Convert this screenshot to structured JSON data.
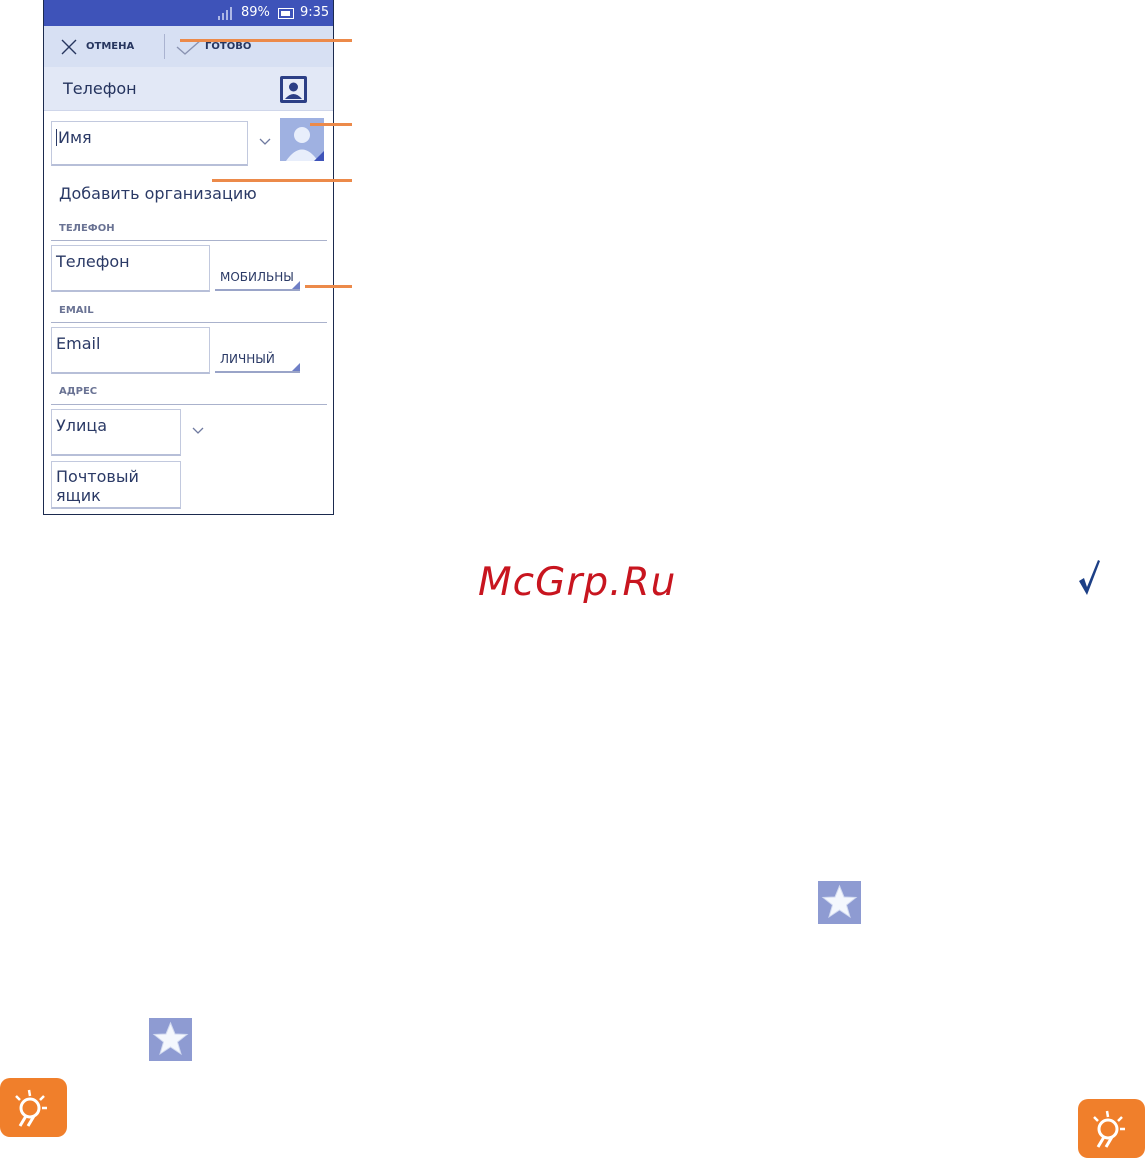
{
  "status_bar": {
    "battery_percent": "89%",
    "time": "9:35",
    "icons": [
      "signal-icon",
      "battery-icon"
    ]
  },
  "action_bar": {
    "cancel_label": "ОТМЕНА",
    "done_label": "ГОТОВО",
    "icons": [
      "close-icon",
      "check-icon"
    ]
  },
  "account": {
    "label": "Телефон",
    "icon": "contact-card-icon"
  },
  "name_field": {
    "placeholder": "Имя",
    "icons": [
      "chevron-down-icon",
      "contact-photo-icon"
    ]
  },
  "add_org_label": "Добавить организацию",
  "sections": {
    "phone": {
      "header": "ТЕЛЕФОН",
      "field_placeholder": "Телефон",
      "type_value": "МОБИЛЬНЫ"
    },
    "email": {
      "header": "EMAIL",
      "field_placeholder": "Email",
      "type_value": "ЛИЧНЫЙ"
    },
    "address": {
      "header": "АДРЕС",
      "street_placeholder": "Улица",
      "pobox_placeholder_line1": "Почтовый",
      "pobox_placeholder_line2": "ящик"
    }
  },
  "watermark": "McGrp.Ru",
  "page_icons": [
    "checkmark-icon",
    "favorite-star-icon",
    "tip-bulb-icon"
  ],
  "colors": {
    "status_bar": "#3e53b9",
    "action_bar": "#d7e0f3",
    "callout": "#ec8a4a",
    "watermark": "#c8151f",
    "tip_icon": "#f07f2b"
  }
}
